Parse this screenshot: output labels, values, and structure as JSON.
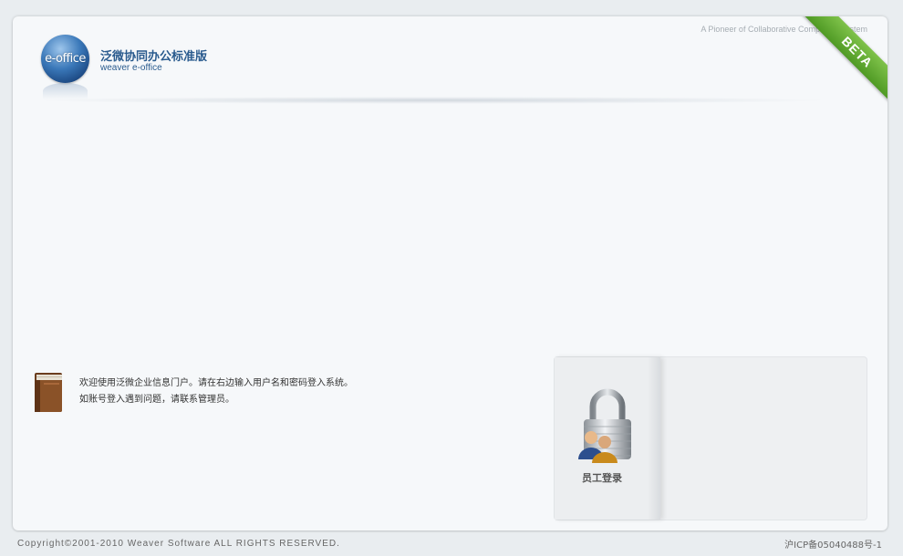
{
  "header": {
    "logo_text": "e-office",
    "brand_title": "泛微协同办公标准版",
    "brand_subtitle": "weaver e-office",
    "tagline": "A Pioneer of Collaborative Computing System"
  },
  "ribbon": {
    "label": "BETA",
    "color": "#5fa82f"
  },
  "welcome": {
    "line1": "欢迎使用泛微企业信息门户。请在右边输入用户名和密码登入系统。",
    "line2": "如账号登入遇到问题，请联系管理员。",
    "icon": "book-icon"
  },
  "login": {
    "label": "员工登录",
    "icon": "lock-users-icon"
  },
  "footer": {
    "copyright": "Copyright©2001-2010 Weaver Software ALL RIGHTS RESERVED.",
    "icp": "沪ICP备05040488号-1"
  },
  "colors": {
    "brand": "#2a5b8e",
    "background": "#e9edf0",
    "card": "#f6f8fa"
  }
}
